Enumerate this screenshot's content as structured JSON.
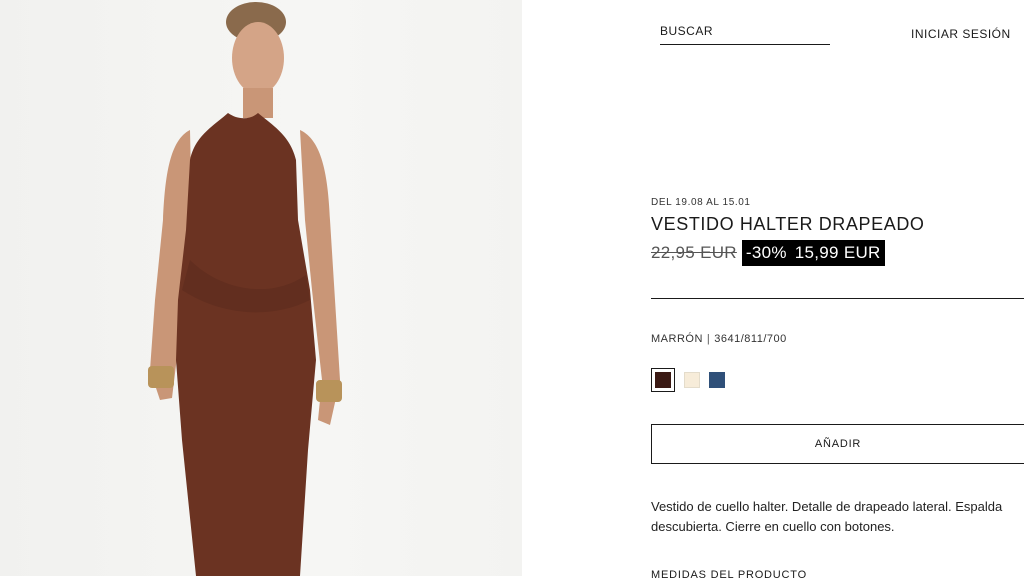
{
  "header": {
    "search_label": "BUSCAR",
    "login_label": "INICIAR SESIÓN"
  },
  "product": {
    "dates": "DEL 19.08 AL 15.01",
    "title": "VESTIDO HALTER DRAPEADO",
    "old_price": "22,95 EUR",
    "discount": "-30%",
    "price": "15,99 EUR",
    "color_name": "MARRÓN",
    "color_separator": "|",
    "reference": "3641/811/700",
    "swatches": [
      {
        "name": "Marrón",
        "color": "#3b1a14",
        "selected": true
      },
      {
        "name": "Crudo",
        "color": "#f7ecd9",
        "selected": false
      },
      {
        "name": "Azul",
        "color": "#2f5079",
        "selected": false
      }
    ],
    "add_label": "AÑADIR",
    "description": "Vestido de cuello halter. Detalle de drapeado lateral. Espalda descubierta. Cierre en cuello con botones.",
    "measures_label": "MEDIDAS DEL PRODUCTO"
  },
  "colors": {
    "dress": "#6b3322",
    "skin": "#c99677",
    "background": "#f4f4f2"
  }
}
